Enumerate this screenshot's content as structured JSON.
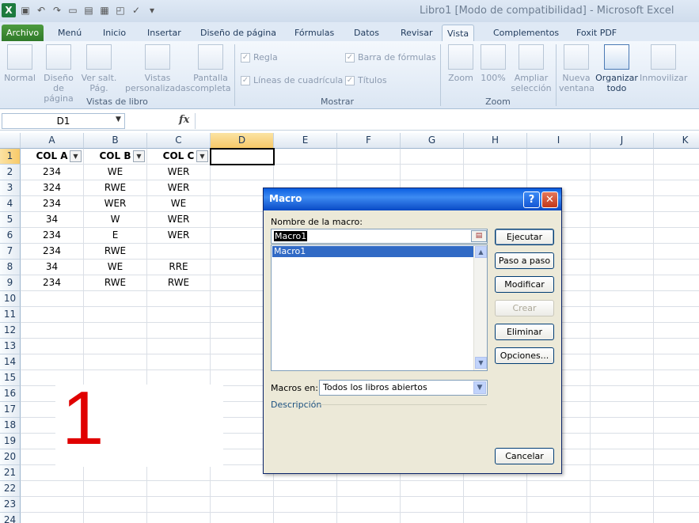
{
  "window": {
    "title": "Libro1  [Modo de compatibilidad]  -  Microsoft Excel",
    "logo": "X"
  },
  "tabs": [
    "Archivo",
    "Menú",
    "Inicio",
    "Insertar",
    "Diseño de página",
    "Fórmulas",
    "Datos",
    "Revisar",
    "Vista",
    "Complementos",
    "Foxit PDF"
  ],
  "active_tab": "Vista",
  "ribbon": {
    "workbook_views": {
      "group": "Vistas de libro",
      "buttons": [
        "Normal",
        "Diseño de página",
        "Ver salt. Pág.",
        "Vistas personalizadas",
        "Pantalla completa"
      ]
    },
    "show": {
      "group": "Mostrar",
      "checks": [
        "Regla",
        "Barra de fórmulas",
        "Líneas de cuadrícula",
        "Títulos"
      ]
    },
    "zoom": {
      "group": "Zoom",
      "buttons": [
        "Zoom",
        "100%",
        "Ampliar selección"
      ]
    },
    "window_group": {
      "buttons": [
        "Nueva ventana",
        "Organizar todo",
        "Inmovilizar"
      ]
    }
  },
  "formula_bar": {
    "name_box": "D1",
    "fx": "fx"
  },
  "columns": [
    "A",
    "B",
    "C",
    "D",
    "E",
    "F",
    "G",
    "H",
    "I",
    "J",
    "K"
  ],
  "rows": [
    "1",
    "2",
    "3",
    "4",
    "5",
    "6",
    "7",
    "8",
    "9",
    "10",
    "11",
    "12",
    "13",
    "14",
    "15",
    "16",
    "17",
    "18",
    "19",
    "20",
    "21",
    "22",
    "23",
    "24"
  ],
  "table": {
    "headers": [
      "COL A",
      "COL B",
      "COL C"
    ],
    "rows": [
      [
        "234",
        "WE",
        "WER"
      ],
      [
        "324",
        "RWE",
        "WER"
      ],
      [
        "234",
        "WER",
        "WE"
      ],
      [
        "34",
        "W",
        "WER"
      ],
      [
        "234",
        "E",
        "WER"
      ],
      [
        "234",
        "RWE",
        ""
      ],
      [
        "34",
        "WE",
        "RRE"
      ],
      [
        "234",
        "RWE",
        "RWE"
      ]
    ]
  },
  "annotation": "1",
  "dialog": {
    "title": "Macro",
    "help": "?",
    "close": "✕",
    "name_label": "Nombre de la macro:",
    "name_value": "Macro1",
    "list_items": [
      "Macro1"
    ],
    "buttons": {
      "run": "Ejecutar",
      "step": "Paso a paso",
      "edit": "Modificar",
      "create": "Crear",
      "delete": "Eliminar",
      "options": "Opciones...",
      "cancel": "Cancelar"
    },
    "macros_in_label": "Macros en:",
    "macros_in_value": "Todos los libros abiertos",
    "description_label": "Descripción"
  },
  "colors": {
    "title_blue": "#0a5ee0",
    "selection": "#316ac5",
    "annotation_red": "#e00000",
    "file_tab": "#2f7a2a"
  }
}
